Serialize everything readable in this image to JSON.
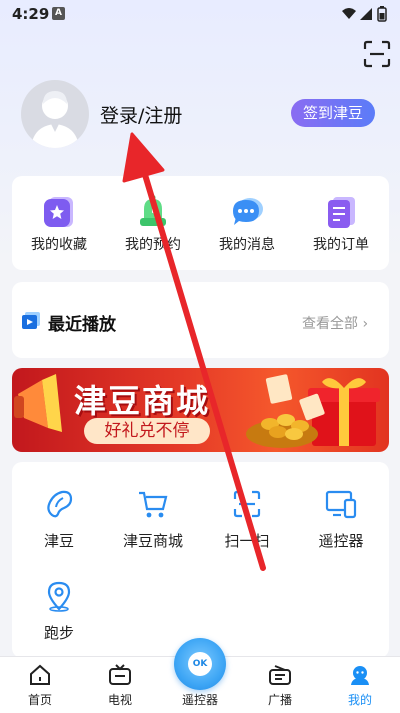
{
  "status_bar": {
    "time": "4:29",
    "notification_letter": "A"
  },
  "profile": {
    "login_label": "登录/注册",
    "signin_button": "签到津豆"
  },
  "quick_actions": [
    {
      "label": "我的收藏",
      "icon": "star-folder-icon"
    },
    {
      "label": "我的预约",
      "icon": "bell-icon"
    },
    {
      "label": "我的消息",
      "icon": "chat-bubble-icon"
    },
    {
      "label": "我的订单",
      "icon": "order-list-icon"
    }
  ],
  "recent": {
    "title": "最近播放",
    "more_label": "查看全部 ›"
  },
  "banner": {
    "title": "津豆商城",
    "subtitle": "好礼兑不停"
  },
  "tools": [
    {
      "label": "津豆",
      "icon": "bean-icon"
    },
    {
      "label": "津豆商城",
      "icon": "shopping-cart-icon"
    },
    {
      "label": "扫一扫",
      "icon": "scan-icon"
    },
    {
      "label": "遥控器",
      "icon": "devices-icon"
    },
    {
      "label": "跑步",
      "icon": "location-pin-icon"
    }
  ],
  "tab_bar": {
    "items": [
      {
        "label": "首页",
        "icon": "home-icon"
      },
      {
        "label": "电视",
        "icon": "tv-icon"
      },
      {
        "label": "遥控器",
        "icon": "remote-icon"
      },
      {
        "label": "广播",
        "icon": "radio-icon"
      },
      {
        "label": "我的",
        "icon": "profile-icon"
      }
    ],
    "active_index": 4,
    "remote_ok_label": "OK"
  },
  "colors": {
    "accent": "#1a8ff5",
    "signin_gradient_start": "#8a6cf2",
    "signin_gradient_end": "#5b7cf8",
    "banner_red": "#e53a27",
    "arrow_red": "#e8262a"
  }
}
